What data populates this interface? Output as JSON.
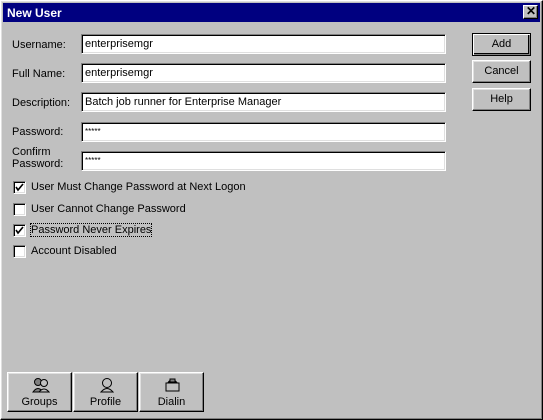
{
  "window": {
    "title": "New User",
    "close_glyph": "✕"
  },
  "fields": {
    "username": {
      "label": "Username:",
      "value": "enterprisemgr"
    },
    "full_name": {
      "label": "Full Name:",
      "value": "enterprisemgr"
    },
    "description": {
      "label": "Description:",
      "value": "Batch job runner for Enterprise Manager"
    },
    "password": {
      "label": "Password:",
      "value": "*****"
    },
    "confirm": {
      "label_line1": "Confirm",
      "label_line2": "Password:",
      "value": "*****"
    }
  },
  "buttons": {
    "add": "Add",
    "cancel": "Cancel",
    "help": "Help"
  },
  "checkboxes": [
    {
      "label": "User Must Change Password at Next Logon",
      "checked": true
    },
    {
      "label": "User Cannot Change Password",
      "checked": false
    },
    {
      "label": "Password Never Expires",
      "checked": true
    },
    {
      "label": "Account Disabled",
      "checked": false
    }
  ],
  "bottom_buttons": [
    {
      "label": "Groups",
      "icon": "groups-icon"
    },
    {
      "label": "Profile",
      "icon": "profile-icon"
    },
    {
      "label": "Dialin",
      "icon": "dialin-icon"
    }
  ],
  "colors": {
    "titlebar": "#000080",
    "face": "#c0c0c0"
  }
}
